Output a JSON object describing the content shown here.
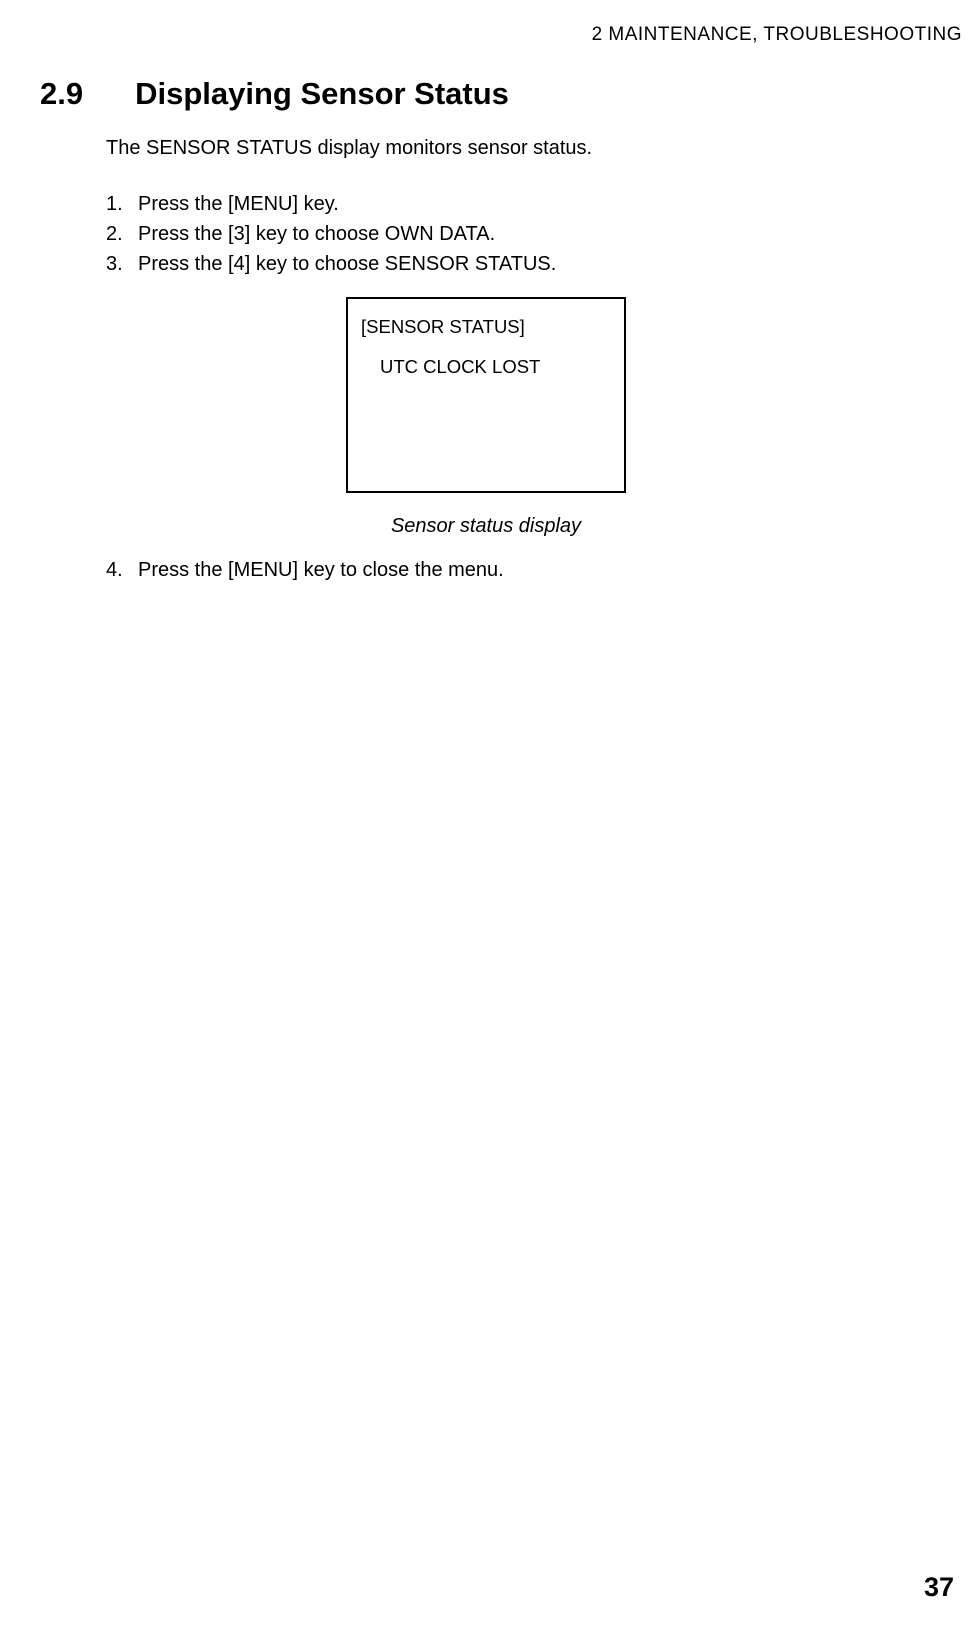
{
  "header": {
    "chapter": "2   MAINTENANCE, TROUBLESHOOTING"
  },
  "section": {
    "number": "2.9",
    "title": "Displaying Sensor Status",
    "intro": "The SENSOR STATUS display monitors sensor status.",
    "steps": [
      {
        "n": "1.",
        "text": "Press the [MENU] key."
      },
      {
        "n": "2.",
        "text": "Press the [3] key to choose OWN DATA."
      },
      {
        "n": "3.",
        "text": "Press the [4] key to choose SENSOR STATUS."
      },
      {
        "n": "4.",
        "text": "Press the [MENU] key to close the menu."
      }
    ],
    "display": {
      "title": "[SENSOR STATUS]",
      "line1": "UTC CLOCK LOST"
    },
    "caption": "Sensor status display"
  },
  "page": "37"
}
